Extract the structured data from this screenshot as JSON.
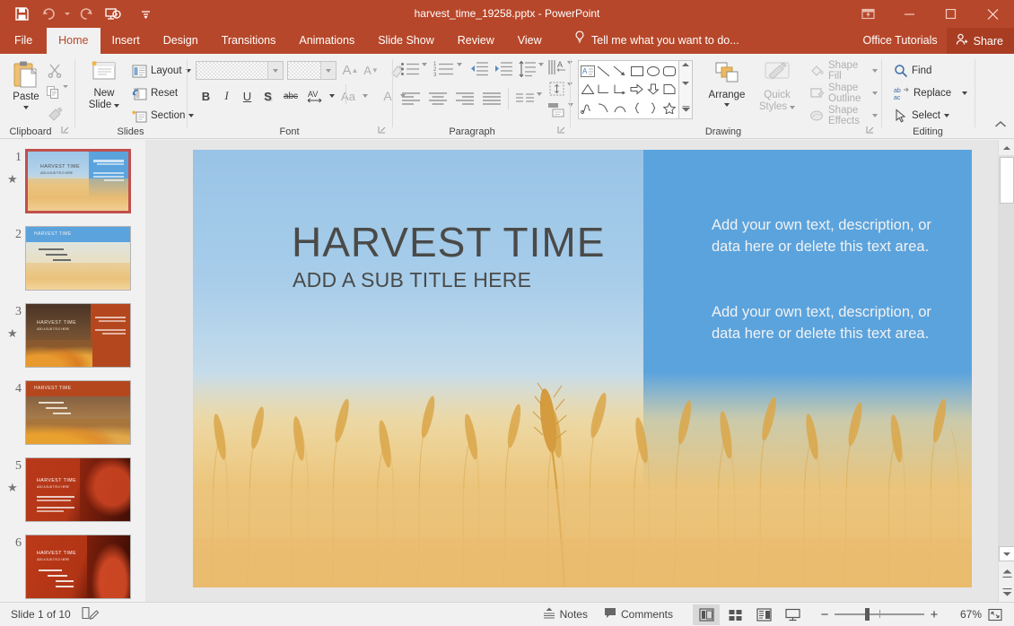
{
  "window": {
    "title": "harvest_time_19258.pptx - PowerPoint",
    "quick_access": [
      {
        "name": "save-icon",
        "label": "Save"
      },
      {
        "name": "undo-icon",
        "label": "Undo"
      },
      {
        "name": "redo-icon",
        "label": "Repeat"
      },
      {
        "name": "start-presentation-icon",
        "label": "Start From Beginning"
      },
      {
        "name": "customize-qat-icon",
        "label": "Customize Quick Access Toolbar"
      }
    ],
    "controls": [
      {
        "name": "ribbon-display-options",
        "label": "Ribbon Display Options"
      },
      {
        "name": "minimize",
        "label": "Minimize"
      },
      {
        "name": "maximize",
        "label": "Maximize"
      },
      {
        "name": "close",
        "label": "Close"
      }
    ],
    "accent_color": "#b7472a",
    "accent_dark": "#a93d22"
  },
  "tabs": {
    "items": [
      {
        "label": "File",
        "active": false
      },
      {
        "label": "Home",
        "active": true
      },
      {
        "label": "Insert",
        "active": false
      },
      {
        "label": "Design",
        "active": false
      },
      {
        "label": "Transitions",
        "active": false
      },
      {
        "label": "Animations",
        "active": false
      },
      {
        "label": "Slide Show",
        "active": false
      },
      {
        "label": "Review",
        "active": false
      },
      {
        "label": "View",
        "active": false
      }
    ],
    "tell_me": "Tell me what you want to do...",
    "office_tutorials": "Office Tutorials",
    "share": "Share"
  },
  "ribbon": {
    "clipboard": {
      "label": "Clipboard",
      "paste": "Paste",
      "cut": "Cut",
      "copy": "Copy",
      "format_painter": "Format Painter"
    },
    "slides": {
      "label": "Slides",
      "new_slide": "New\nSlide",
      "new_slide_line1": "New",
      "new_slide_line2": "Slide",
      "layout": "Layout",
      "reset": "Reset",
      "section": "Section"
    },
    "font": {
      "label": "Font",
      "font_name": "",
      "font_size": "",
      "increase_size": "A",
      "decrease_size": "A",
      "clear_formatting": "Clear All Formatting",
      "bold": "B",
      "italic": "I",
      "underline": "U",
      "shadow": "S",
      "strikethrough": "abc",
      "character_spacing": "AV",
      "change_case": "Aa",
      "font_color": "A"
    },
    "paragraph": {
      "label": "Paragraph",
      "bullets": "Bullets",
      "numbering": "Numbering",
      "decrease_indent": "Decrease List Level",
      "increase_indent": "Increase List Level",
      "line_spacing": "Line Spacing",
      "text_direction": "Text Direction",
      "align_text": "Align Text",
      "convert_smartart": "Convert to SmartArt",
      "align_left": "Align Left",
      "align_center": "Center",
      "align_right": "Align Right",
      "justify": "Justify",
      "columns": "Columns"
    },
    "drawing": {
      "label": "Drawing",
      "arrange": "Arrange",
      "quick_styles_line1": "Quick",
      "quick_styles_line2": "Styles",
      "shape_fill": "Shape Fill",
      "shape_outline": "Shape Outline",
      "shape_effects": "Shape Effects"
    },
    "editing": {
      "label": "Editing",
      "find": "Find",
      "replace": "Replace",
      "select": "Select"
    },
    "collapse_ribbon": "Collapse the Ribbon"
  },
  "thumbnails": [
    {
      "number": "1",
      "selected": true,
      "has_animation": true,
      "theme": "wheat-blue"
    },
    {
      "number": "2",
      "selected": false,
      "has_animation": false,
      "theme": "wheat-header"
    },
    {
      "number": "3",
      "selected": false,
      "has_animation": true,
      "theme": "pumpkin-dark"
    },
    {
      "number": "4",
      "selected": false,
      "has_animation": false,
      "theme": "pumpkin-header"
    },
    {
      "number": "5",
      "selected": false,
      "has_animation": true,
      "theme": "red-leaf"
    },
    {
      "number": "6",
      "selected": false,
      "has_animation": false,
      "theme": "red-leaf-2"
    }
  ],
  "thumb_text": {
    "title": "HARVEST TIME",
    "subtitle": "ADD A SUB TITLE HERE"
  },
  "slide": {
    "title": "HARVEST TIME",
    "subtitle": "ADD A SUB TITLE HERE",
    "body_paragraph_1": "Add your own text, description, or data here or delete this text area.",
    "body_paragraph_2": "Add your own text, description, or data here or delete this text area.",
    "sky_color": "#9dc5e8",
    "panel_color": "#5ba3dd",
    "wheat_color": "#e5b567"
  },
  "status": {
    "slide_counter": "Slide 1 of 10",
    "notes_toggle": "Notes",
    "comments": "Comments",
    "zoom_level": "67%",
    "views": [
      {
        "name": "normal-view",
        "label": "Normal",
        "active": true
      },
      {
        "name": "slide-sorter-view",
        "label": "Slide Sorter",
        "active": false
      },
      {
        "name": "reading-view",
        "label": "Reading View",
        "active": false
      },
      {
        "name": "slide-show-view",
        "label": "Slide Show",
        "active": false
      }
    ],
    "zoom_out": "Zoom Out",
    "zoom_in": "Zoom In",
    "fit_slide": "Fit slide to current window"
  }
}
